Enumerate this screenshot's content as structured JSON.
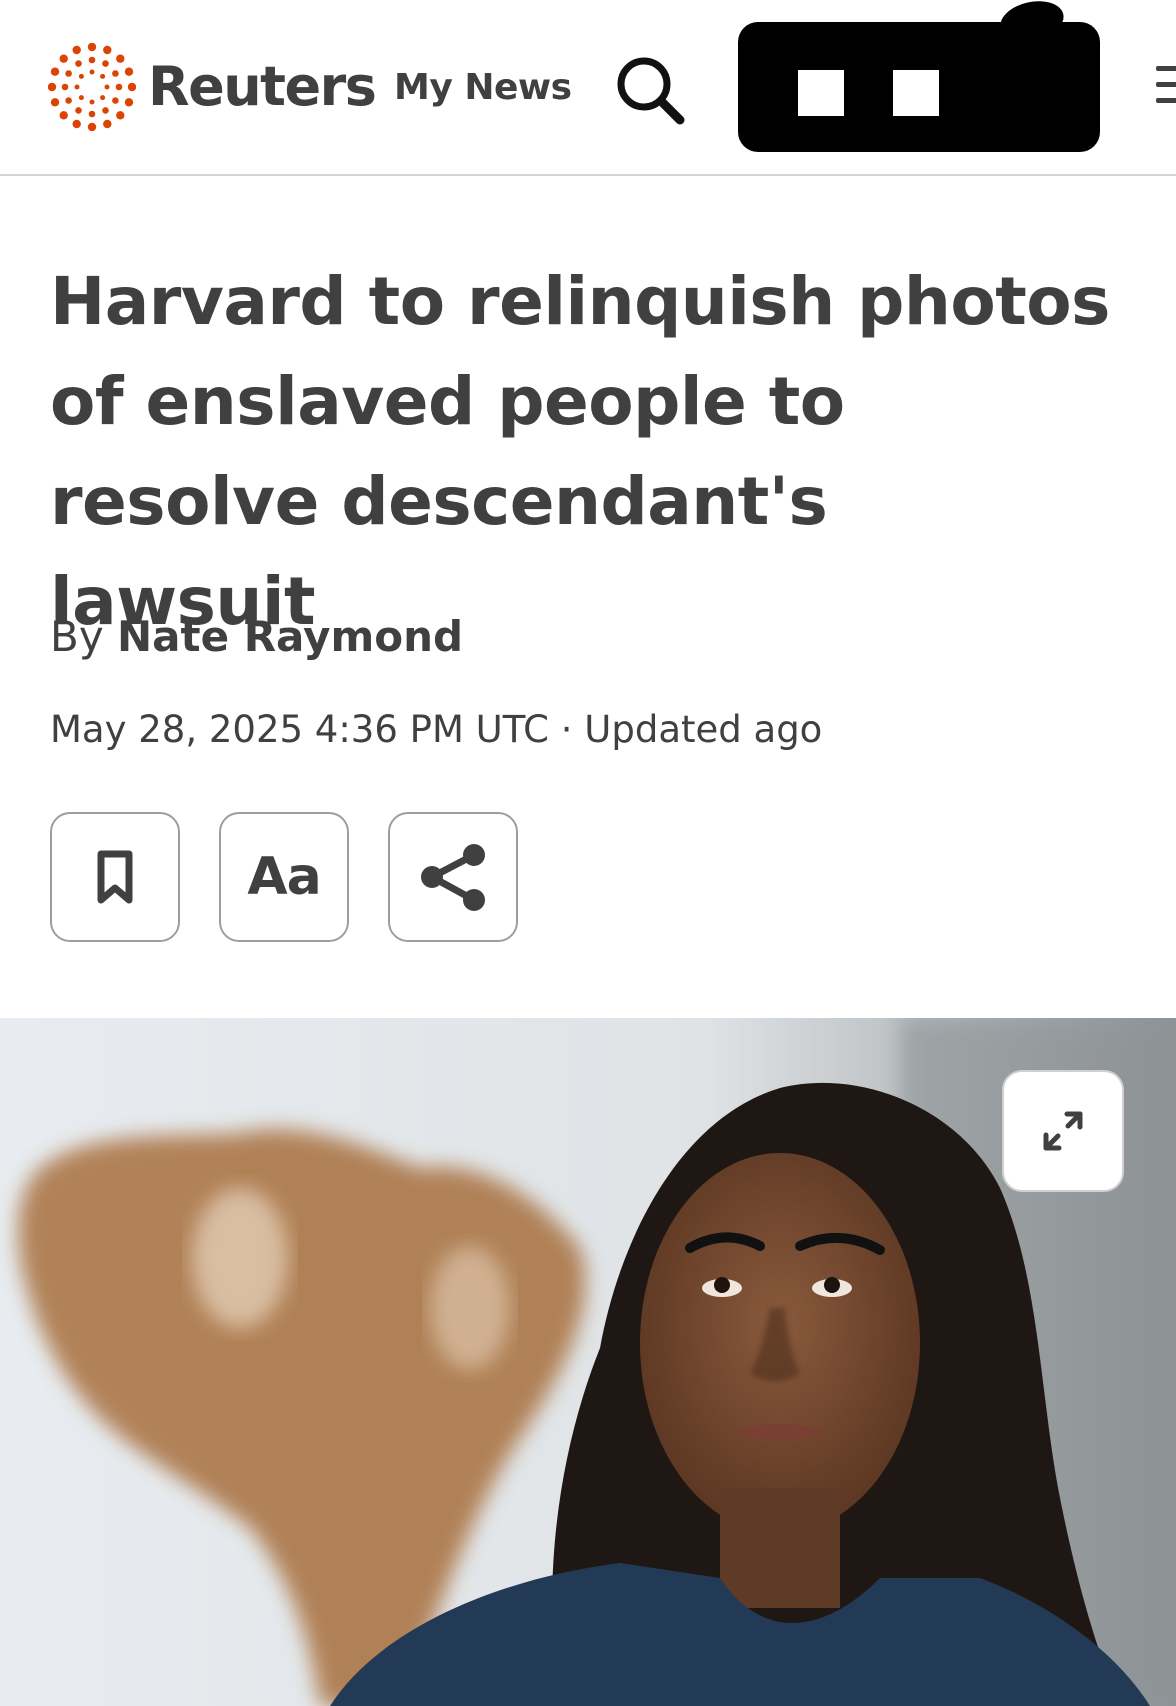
{
  "header": {
    "brand": "Reuters",
    "my_news_label": "My News",
    "search_icon": "search-icon",
    "menu_icon": "hamburger-menu-icon",
    "brand_color": "#dc4405"
  },
  "article": {
    "headline": "Harvard to relinquish photos of enslaved people to resolve descendant's lawsuit",
    "byline_prefix": "By",
    "author": "Nate Raymond",
    "date": "May 28, 2025 4:36 PM UTC",
    "separator": "·",
    "updated": "Updated ago"
  },
  "toolbar": {
    "bookmark_icon": "bookmark-icon",
    "text_size_label": "Aa",
    "share_icon": "share-icon"
  },
  "hero_image": {
    "expand_icon": "expand-icon"
  },
  "colors": {
    "text": "#404040",
    "border": "#9e9e9e",
    "divider": "#d4d4d4",
    "redaction": "#000000"
  }
}
